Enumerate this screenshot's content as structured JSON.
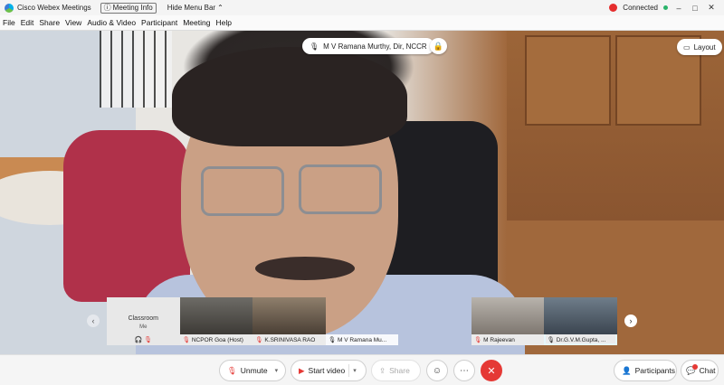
{
  "titlebar": {
    "app_title": "Cisco Webex Meetings",
    "meeting_info": "Meeting Info",
    "hide_menu": "Hide Menu Bar",
    "status": "Connected",
    "min": "–",
    "max": "□",
    "close": "✕"
  },
  "menu": [
    "File",
    "Edit",
    "Share",
    "View",
    "Audio & Video",
    "Participant",
    "Meeting",
    "Help"
  ],
  "active_speaker": {
    "name": "M V Ramana Murthy, Dir, NCCR"
  },
  "layout_label": "Layout",
  "thumbnails": {
    "self": {
      "name": "Classroom",
      "sub": "Me"
    },
    "items": [
      {
        "name": "NCPOR Goa (Host)"
      },
      {
        "name": "K.SRINIVASA RAO"
      },
      {
        "name": "M V Ramana Mu..."
      },
      {
        "name": ""
      },
      {
        "name": "M Rajeevan"
      },
      {
        "name": "Dr.G.V.M.Gupta, ..."
      }
    ]
  },
  "controls": {
    "unmute": "Unmute",
    "start_video": "Start video",
    "share": "Share",
    "participants": "Participants",
    "chat": "Chat"
  },
  "colors": {
    "end_call": "#e53935",
    "active_tile": "#00a0d1",
    "connected": "#2ab36a"
  }
}
